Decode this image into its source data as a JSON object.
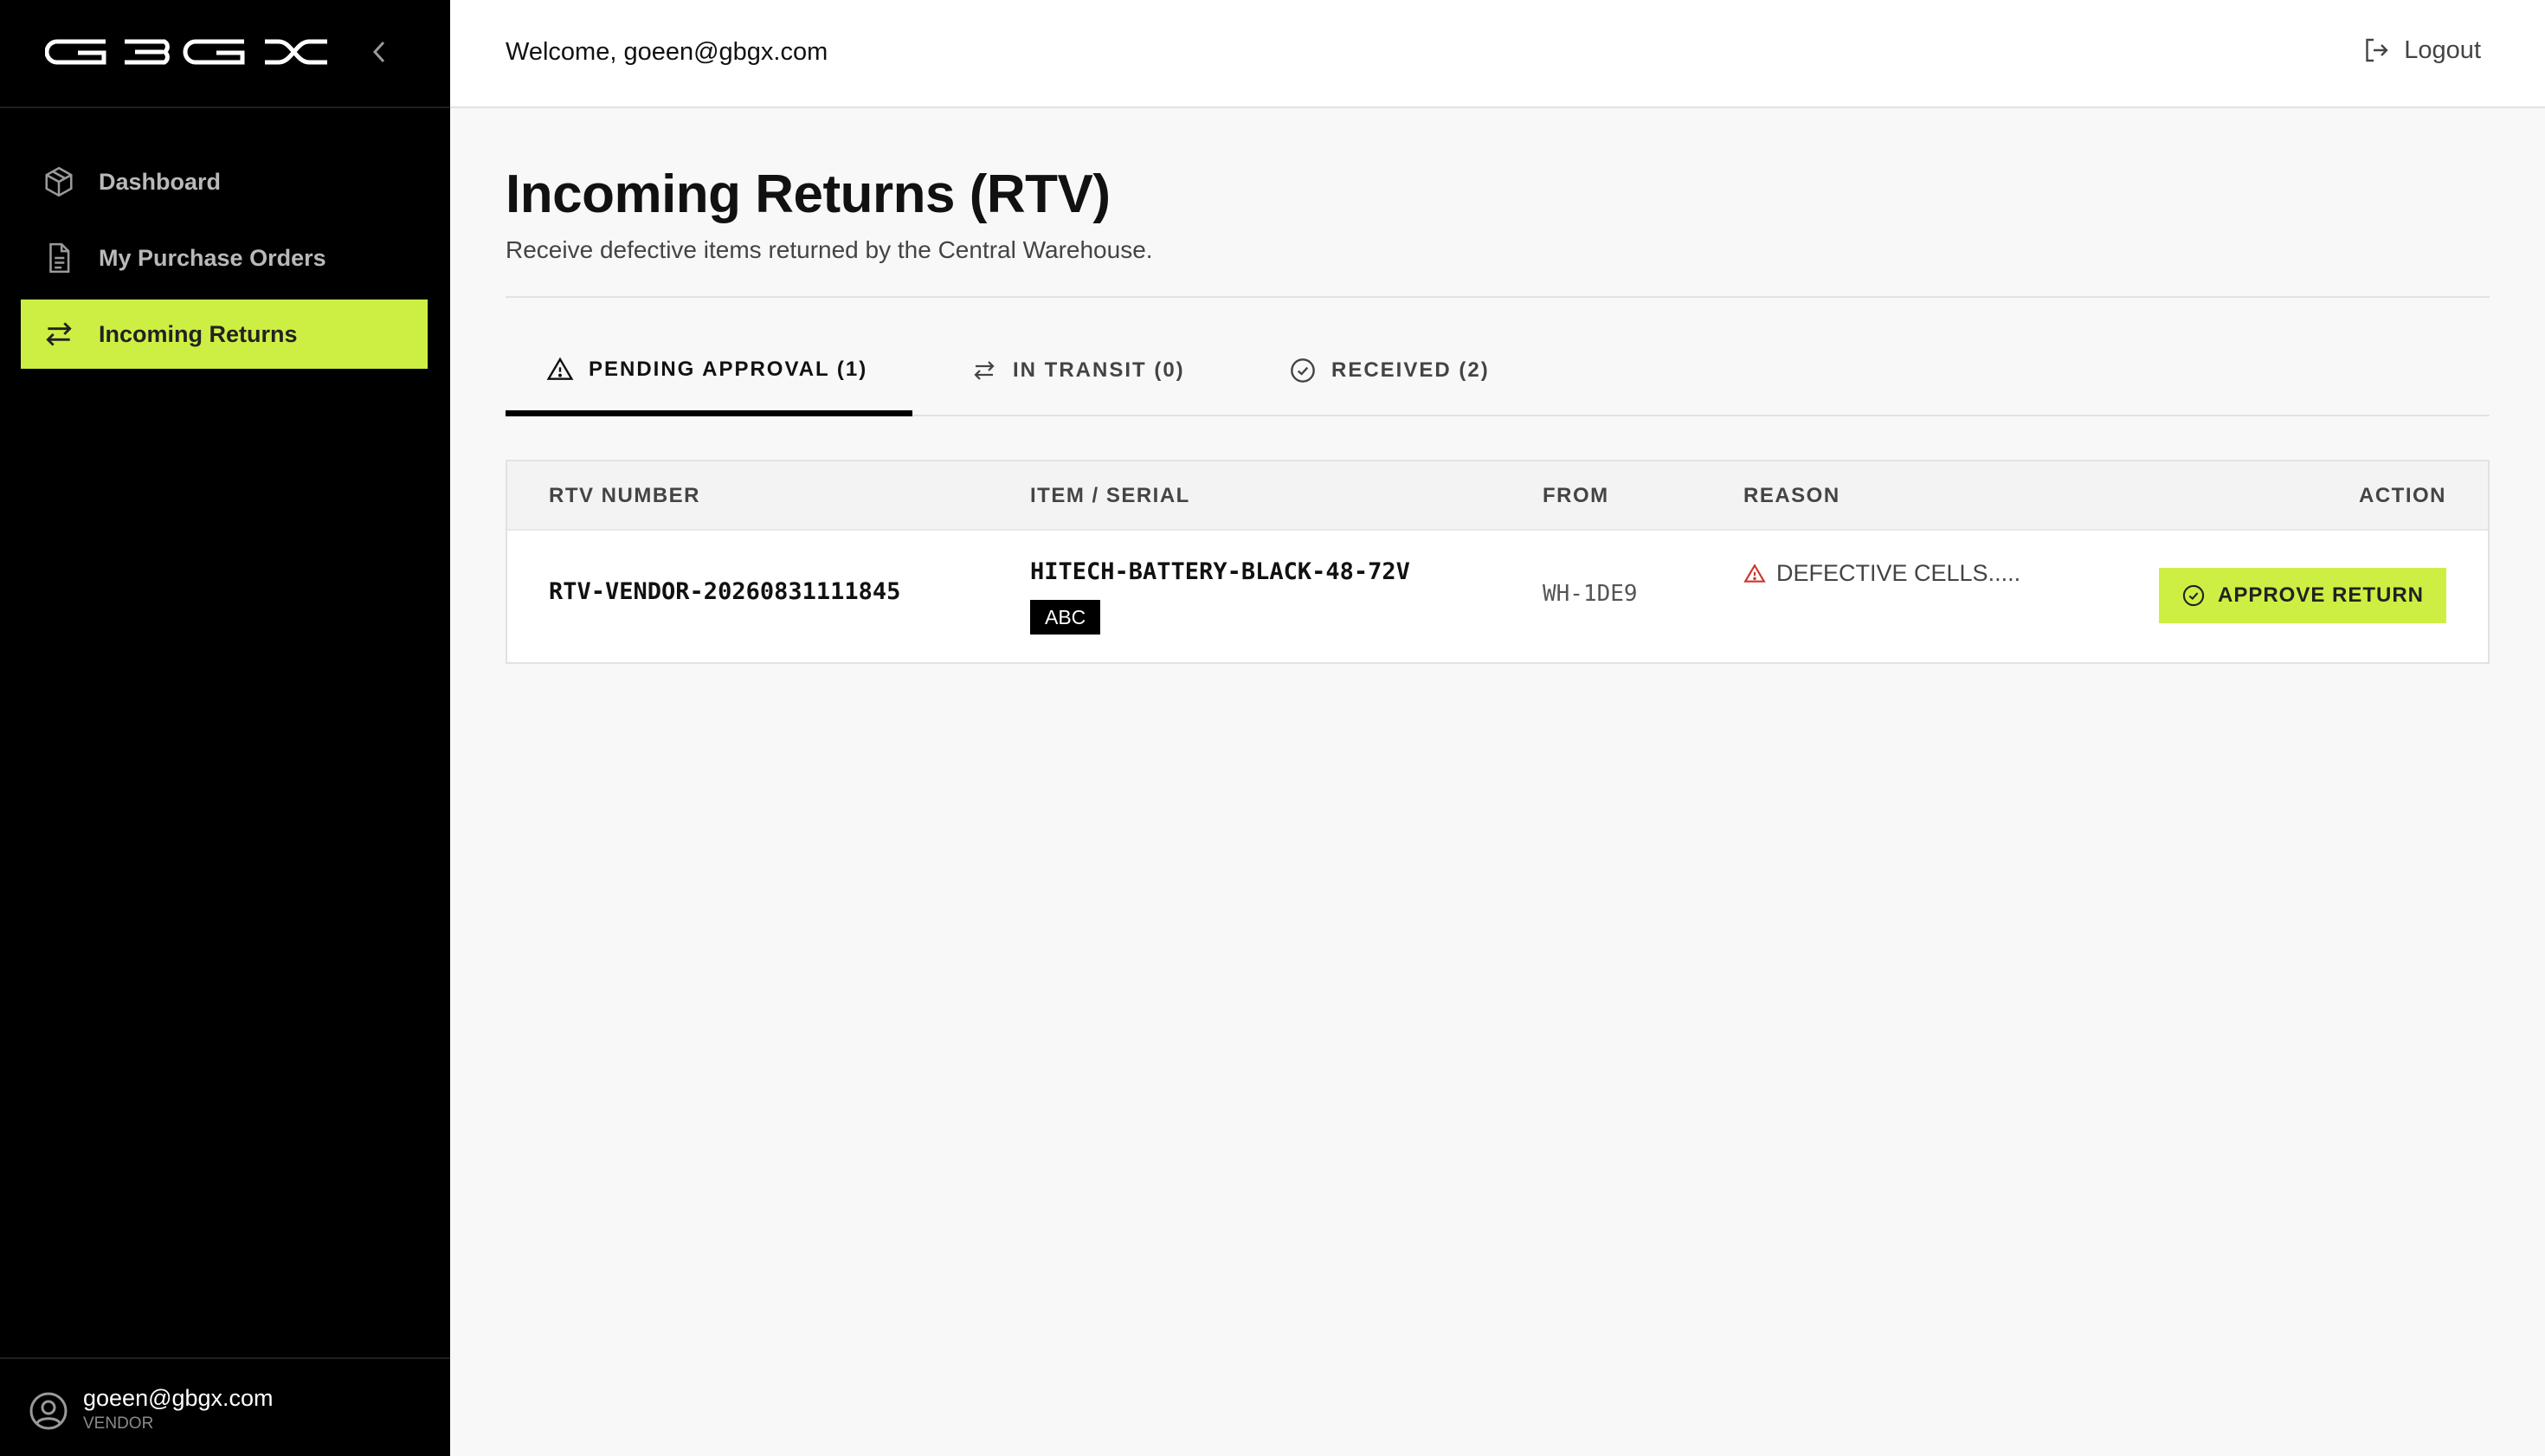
{
  "app": {
    "logo_text": "GBGX"
  },
  "sidebar": {
    "items": [
      {
        "label": "Dashboard",
        "icon": "package-icon",
        "active": false
      },
      {
        "label": "My Purchase Orders",
        "icon": "document-icon",
        "active": false
      },
      {
        "label": "Incoming Returns",
        "icon": "swap-arrows-icon",
        "active": true
      }
    ],
    "user": {
      "email": "goeen@gbgx.com",
      "role": "VENDOR"
    }
  },
  "header": {
    "welcome": "Welcome, goeen@gbgx.com",
    "logout_label": "Logout"
  },
  "page": {
    "title": "Incoming Returns (RTV)",
    "subtitle": "Receive defective items returned by the Central Warehouse."
  },
  "tabs": [
    {
      "label": "PENDING APPROVAL (1)",
      "icon": "warning-triangle-icon",
      "active": true
    },
    {
      "label": "IN TRANSIT (0)",
      "icon": "swap-arrows-icon",
      "active": false
    },
    {
      "label": "RECEIVED (2)",
      "icon": "check-circle-icon",
      "active": false
    }
  ],
  "table": {
    "columns": [
      "RTV NUMBER",
      "ITEM / SERIAL",
      "FROM",
      "REASON",
      "ACTION"
    ],
    "rows": [
      {
        "rtv_number": "RTV-VENDOR-20260831111845",
        "item": "HITECH-BATTERY-BLACK-48-72V",
        "serial": "ABC",
        "from": "WH-1DE9",
        "reason": "DEFECTIVE CELLS.....",
        "action_label": "APPROVE RETURN"
      }
    ]
  },
  "colors": {
    "accent": "#cdef44",
    "sidebar_bg": "#000000",
    "warning": "#d0342c"
  }
}
